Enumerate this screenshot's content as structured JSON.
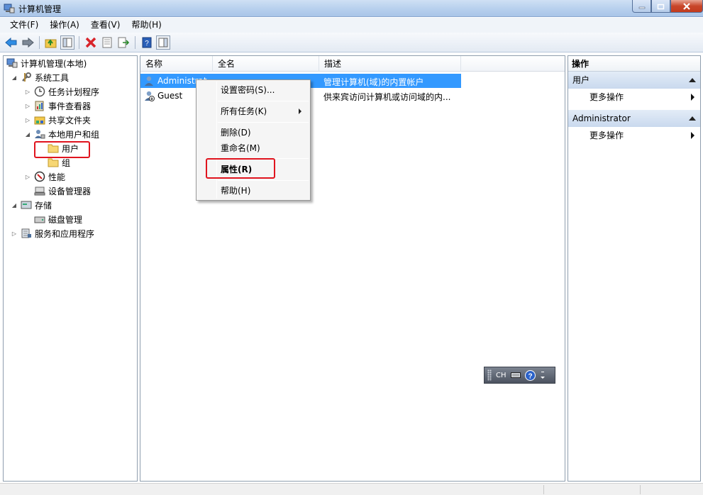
{
  "window": {
    "title": "计算机管理"
  },
  "menubar": [
    "文件(F)",
    "操作(A)",
    "查看(V)",
    "帮助(H)"
  ],
  "tree": [
    {
      "label": "计算机管理(本地)",
      "depth": 0,
      "expander": "",
      "icon": "computer-management-icon"
    },
    {
      "label": "系统工具",
      "depth": 1,
      "expander": "◢",
      "icon": "tools-icon"
    },
    {
      "label": "任务计划程序",
      "depth": 2,
      "expander": "▷",
      "icon": "clock-icon"
    },
    {
      "label": "事件查看器",
      "depth": 2,
      "expander": "▷",
      "icon": "event-viewer-icon"
    },
    {
      "label": "共享文件夹",
      "depth": 2,
      "expander": "▷",
      "icon": "shared-folder-icon"
    },
    {
      "label": "本地用户和组",
      "depth": 2,
      "expander": "◢",
      "icon": "users-group-icon"
    },
    {
      "label": "用户",
      "depth": 3,
      "expander": "",
      "icon": "folder-icon"
    },
    {
      "label": "组",
      "depth": 3,
      "expander": "",
      "icon": "folder-icon"
    },
    {
      "label": "性能",
      "depth": 2,
      "expander": "▷",
      "icon": "performance-icon"
    },
    {
      "label": "设备管理器",
      "depth": 2,
      "expander": "",
      "icon": "device-manager-icon"
    },
    {
      "label": "存储",
      "depth": 0,
      "expander": "◢",
      "icon": "storage-icon"
    },
    {
      "label": "磁盘管理",
      "depth": 2,
      "expander": "",
      "icon": "disk-icon"
    },
    {
      "label": "服务和应用程序",
      "depth": 0,
      "expander": "▷",
      "icon": "services-icon"
    }
  ],
  "list": {
    "columns": [
      "名称",
      "全名",
      "描述"
    ],
    "rows": [
      {
        "name": "Administrat",
        "fullname": "",
        "desc": "管理计算机(域)的内置帐户",
        "selected": true
      },
      {
        "name": "Guest",
        "fullname": "",
        "desc": "供来宾访问计算机或访问域的内...",
        "selected": false
      }
    ]
  },
  "context_menu": {
    "items": [
      "设置密码(S)...",
      "所有任务(K)",
      "删除(D)",
      "重命名(M)",
      "属性(R)",
      "帮助(H)"
    ]
  },
  "actions": {
    "title": "操作",
    "sections": [
      {
        "name": "用户",
        "item": "更多操作"
      },
      {
        "name": "Administrator",
        "item": "更多操作"
      }
    ]
  },
  "langbar": {
    "lang": "CH"
  },
  "colors": {
    "selection": "#3399ff",
    "highlight_box": "#e0141e"
  }
}
